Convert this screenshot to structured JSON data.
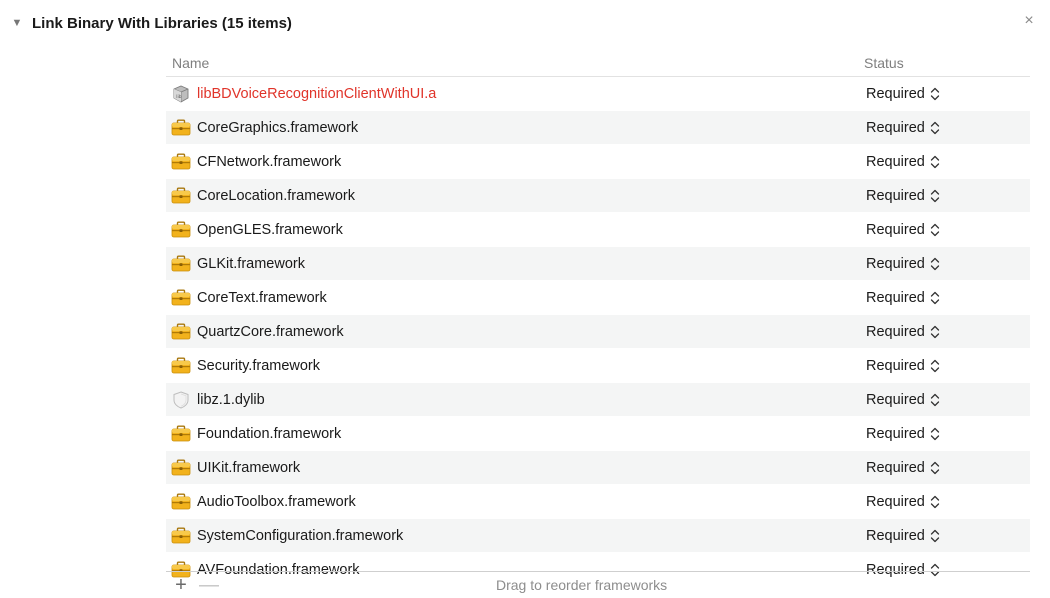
{
  "section": {
    "title": "Link Binary With Libraries (15 items)",
    "disclosure_symbol": "▼",
    "close_symbol": "×"
  },
  "table": {
    "columns": {
      "name": "Name",
      "status": "Status"
    },
    "rows": [
      {
        "name": "libBDVoiceRecognitionClientWithUI.a",
        "status": "Required",
        "icon": "static-library-icon",
        "missing": true
      },
      {
        "name": "CoreGraphics.framework",
        "status": "Required",
        "icon": "framework-toolbox-icon",
        "missing": false
      },
      {
        "name": "CFNetwork.framework",
        "status": "Required",
        "icon": "framework-toolbox-icon",
        "missing": false
      },
      {
        "name": "CoreLocation.framework",
        "status": "Required",
        "icon": "framework-toolbox-icon",
        "missing": false
      },
      {
        "name": "OpenGLES.framework",
        "status": "Required",
        "icon": "framework-toolbox-icon",
        "missing": false
      },
      {
        "name": "GLKit.framework",
        "status": "Required",
        "icon": "framework-toolbox-icon",
        "missing": false
      },
      {
        "name": "CoreText.framework",
        "status": "Required",
        "icon": "framework-toolbox-icon",
        "missing": false
      },
      {
        "name": "QuartzCore.framework",
        "status": "Required",
        "icon": "framework-toolbox-icon",
        "missing": false
      },
      {
        "name": "Security.framework",
        "status": "Required",
        "icon": "framework-toolbox-icon",
        "missing": false
      },
      {
        "name": "libz.1.dylib",
        "status": "Required",
        "icon": "dylib-shield-icon",
        "missing": false
      },
      {
        "name": "Foundation.framework",
        "status": "Required",
        "icon": "framework-toolbox-icon",
        "missing": false
      },
      {
        "name": "UIKit.framework",
        "status": "Required",
        "icon": "framework-toolbox-icon",
        "missing": false
      },
      {
        "name": "AudioToolbox.framework",
        "status": "Required",
        "icon": "framework-toolbox-icon",
        "missing": false
      },
      {
        "name": "SystemConfiguration.framework",
        "status": "Required",
        "icon": "framework-toolbox-icon",
        "missing": false
      },
      {
        "name": "AVFoundation.framework",
        "status": "Required",
        "icon": "framework-toolbox-icon",
        "missing": false
      }
    ]
  },
  "footer": {
    "add_symbol": "+",
    "remove_symbol": "—",
    "hint": "Drag to reorder frameworks"
  },
  "colors": {
    "missing_text": "#e0342a",
    "framework_icon": "#f0b31b",
    "header_text": "#7f7f7f"
  }
}
